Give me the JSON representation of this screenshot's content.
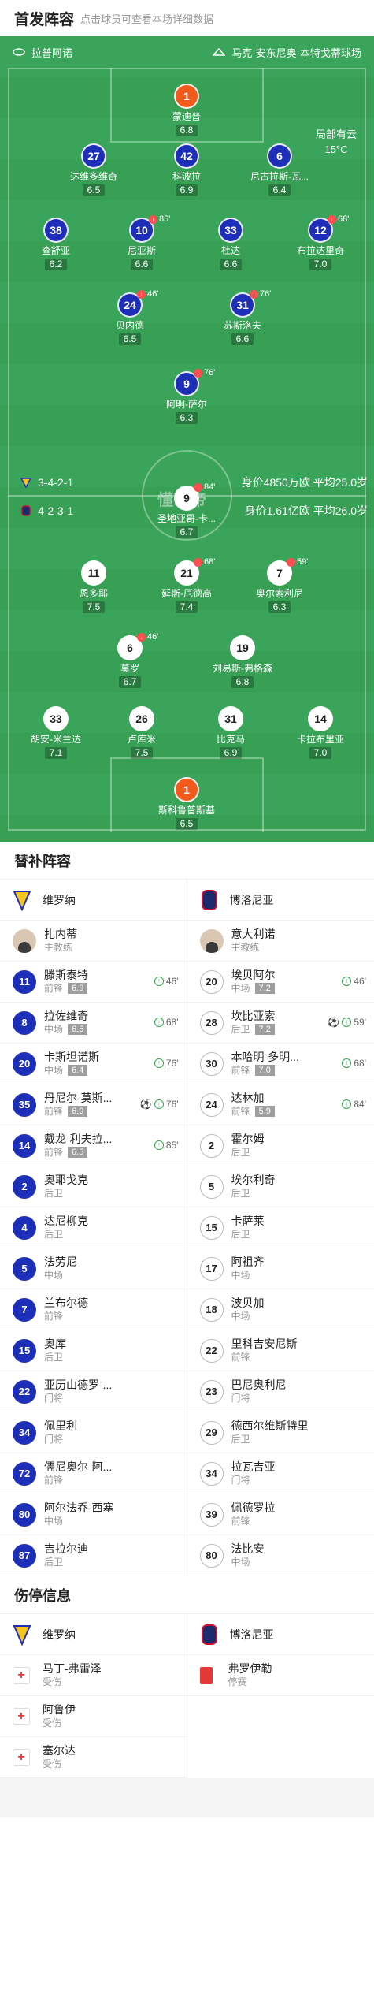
{
  "header": {
    "title": "首发阵容",
    "subtitle": "点击球员可查看本场详细数据"
  },
  "pitch": {
    "home_team": "拉普阿诺",
    "venue": "马克·安东尼奥·本特戈蒂球场",
    "weather": "局部有云",
    "temperature": "15°C",
    "watermark": "懂球帝"
  },
  "formations": {
    "home": {
      "shape": "3-4-2-1",
      "value": "身价4850万欧 平均25.0岁"
    },
    "away": {
      "shape": "4-2-3-1",
      "value": "身价1.61亿欧 平均26.0岁"
    }
  },
  "players": [
    {
      "num": "1",
      "name": "蒙迪普",
      "rating": "6.8",
      "color": "orange"
    },
    {
      "num": "27",
      "name": "达维多维奇",
      "rating": "6.5",
      "color": "blue"
    },
    {
      "num": "42",
      "name": "科波拉",
      "rating": "6.9",
      "color": "blue"
    },
    {
      "num": "6",
      "name": "尼古拉斯-瓦...",
      "rating": "6.4",
      "color": "blue"
    },
    {
      "num": "38",
      "name": "查舒亚",
      "rating": "6.2",
      "color": "blue"
    },
    {
      "num": "10",
      "name": "尼亚斯",
      "rating": "6.6",
      "color": "blue",
      "sub": "85'"
    },
    {
      "num": "33",
      "name": "杜达",
      "rating": "6.6",
      "color": "blue"
    },
    {
      "num": "12",
      "name": "布拉达里奇",
      "rating": "7.0",
      "color": "blue",
      "sub": "68'"
    },
    {
      "num": "24",
      "name": "贝内德",
      "rating": "6.5",
      "color": "blue",
      "sub": "46'"
    },
    {
      "num": "31",
      "name": "苏斯洛夫",
      "rating": "6.6",
      "color": "blue",
      "sub": "76'"
    },
    {
      "num": "9",
      "name": "阿明-萨尔",
      "rating": "6.3",
      "color": "blue",
      "sub": "76'"
    },
    {
      "num": "9",
      "name": "圣地亚哥-卡...",
      "rating": "6.7",
      "color": "white",
      "sub": "84'"
    },
    {
      "num": "11",
      "name": "恩多耶",
      "rating": "7.5",
      "color": "white"
    },
    {
      "num": "21",
      "name": "延斯-厄德高",
      "rating": "7.4",
      "color": "white",
      "sub": "68'"
    },
    {
      "num": "7",
      "name": "奥尔索利尼",
      "rating": "6.3",
      "color": "white",
      "sub": "59'"
    },
    {
      "num": "6",
      "name": "莫罗",
      "rating": "6.7",
      "color": "white",
      "sub": "46'"
    },
    {
      "num": "19",
      "name": "刘易斯-弗格森",
      "rating": "6.8",
      "color": "white"
    },
    {
      "num": "33",
      "name": "胡安-米兰达",
      "rating": "7.1",
      "color": "white"
    },
    {
      "num": "26",
      "name": "卢库米",
      "rating": "7.5",
      "color": "white"
    },
    {
      "num": "31",
      "name": "比克马",
      "rating": "6.9",
      "color": "white"
    },
    {
      "num": "14",
      "name": "卡拉布里亚",
      "rating": "7.0",
      "color": "white"
    },
    {
      "num": "1",
      "name": "斯科鲁普斯基",
      "rating": "6.5",
      "color": "orange"
    }
  ],
  "subs": {
    "title": "替补阵容",
    "left_team": "维罗纳",
    "right_team": "博洛尼亚",
    "left_coach": {
      "name": "扎内蒂",
      "role": "主教练"
    },
    "right_coach": {
      "name": "意大利诺",
      "role": "主教练"
    },
    "left": [
      {
        "num": "11",
        "name": "滕斯泰特",
        "pos": "前锋",
        "rating": "6.9",
        "time": "46'"
      },
      {
        "num": "8",
        "name": "拉佐维奇",
        "pos": "中场",
        "rating": "6.5",
        "time": "68'"
      },
      {
        "num": "20",
        "name": "卡斯坦诺斯",
        "pos": "中场",
        "rating": "6.4",
        "time": "76'"
      },
      {
        "num": "35",
        "name": "丹尼尔-莫斯...",
        "pos": "前锋",
        "rating": "6.9",
        "time": "76'",
        "goal": true
      },
      {
        "num": "14",
        "name": "戴龙-利夫拉...",
        "pos": "前锋",
        "rating": "6.5",
        "time": "85'"
      },
      {
        "num": "2",
        "name": "奥耶戈克",
        "pos": "后卫"
      },
      {
        "num": "4",
        "name": "达尼柳克",
        "pos": "后卫"
      },
      {
        "num": "5",
        "name": "法劳尼",
        "pos": "中场"
      },
      {
        "num": "7",
        "name": "兰布尔德",
        "pos": "前锋"
      },
      {
        "num": "15",
        "name": "奥库",
        "pos": "后卫"
      },
      {
        "num": "22",
        "name": "亚历山德罗-...",
        "pos": "门将"
      },
      {
        "num": "34",
        "name": "佩里利",
        "pos": "门将"
      },
      {
        "num": "72",
        "name": "儒尼奥尔-阿...",
        "pos": "前锋"
      },
      {
        "num": "80",
        "name": "阿尔法乔-西塞",
        "pos": "中场"
      },
      {
        "num": "87",
        "name": "吉拉尔迪",
        "pos": "后卫"
      }
    ],
    "right": [
      {
        "num": "20",
        "name": "埃贝阿尔",
        "pos": "中场",
        "rating": "7.2",
        "time": "46'"
      },
      {
        "num": "28",
        "name": "坎比亚索",
        "pos": "后卫",
        "rating": "7.2",
        "time": "59'",
        "goal": true
      },
      {
        "num": "30",
        "name": "本哈明-多明...",
        "pos": "前锋",
        "rating": "7.0",
        "time": "68'"
      },
      {
        "num": "24",
        "name": "达林加",
        "pos": "前锋",
        "rating": "5.9",
        "time": "84'"
      },
      {
        "num": "2",
        "name": "霍尔姆",
        "pos": "后卫"
      },
      {
        "num": "5",
        "name": "埃尔利奇",
        "pos": "后卫"
      },
      {
        "num": "15",
        "name": "卡萨莱",
        "pos": "后卫"
      },
      {
        "num": "17",
        "name": "阿祖齐",
        "pos": "中场"
      },
      {
        "num": "18",
        "name": "波贝加",
        "pos": "中场"
      },
      {
        "num": "22",
        "name": "里科吉安尼斯",
        "pos": "前锋"
      },
      {
        "num": "23",
        "name": "巴尼奥利尼",
        "pos": "门将"
      },
      {
        "num": "29",
        "name": "德西尔维斯特里",
        "pos": "后卫"
      },
      {
        "num": "34",
        "name": "拉瓦吉亚",
        "pos": "门将"
      },
      {
        "num": "39",
        "name": "佩德罗拉",
        "pos": "前锋"
      },
      {
        "num": "80",
        "name": "法比安",
        "pos": "中场"
      }
    ]
  },
  "injuries": {
    "title": "伤停信息",
    "left_team": "维罗纳",
    "right_team": "博洛尼亚",
    "left": [
      {
        "name": "马丁-弗雷泽",
        "status": "受伤"
      },
      {
        "name": "阿鲁伊",
        "status": "受伤"
      },
      {
        "name": "塞尔达",
        "status": "受伤"
      }
    ],
    "right": [
      {
        "name": "弗罗伊勒",
        "status": "停赛"
      }
    ]
  }
}
